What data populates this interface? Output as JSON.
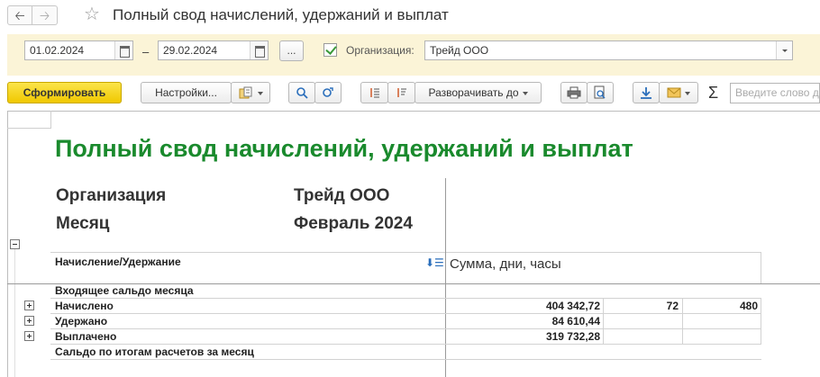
{
  "window": {
    "title": "Полный свод начислений, удержаний и выплат"
  },
  "params": {
    "date_from": "01.02.2024",
    "date_to": "29.02.2024",
    "period_sep": "–",
    "select_period_label": "...",
    "org_checked": true,
    "org_label": "Организация:",
    "org_value": "Трейд ООО"
  },
  "toolbar": {
    "generate_label": "Сформировать",
    "settings_label": "Настройки...",
    "expand_label": "Разворачивать до",
    "sum_symbol": "Σ",
    "search_placeholder": "Введите слово д"
  },
  "report": {
    "title": "Полный свод начислений, удержаний и выплат",
    "org_caption": "Организация",
    "org_value": "Трейд ООО",
    "month_caption": "Месяц",
    "month_value": "Февраль 2024",
    "col_item_header": "Начисление/Удержание",
    "col_sum_header": "Сумма, дни, часы",
    "rows": [
      {
        "label": "Входящее сальдо месяца",
        "sum": "",
        "days": "",
        "hours": ""
      },
      {
        "label": "Начислено",
        "sum": "404 342,72",
        "days": "72",
        "hours": "480"
      },
      {
        "label": "Удержано",
        "sum": "84 610,44",
        "days": "",
        "hours": ""
      },
      {
        "label": "Выплачено",
        "sum": "319 732,28",
        "days": "",
        "hours": ""
      },
      {
        "label": "Сальдо по итогам расчетов за месяц",
        "sum": "",
        "days": "",
        "hours": ""
      }
    ]
  },
  "colors": {
    "accent_yellow": "#f0c800",
    "params_bg": "#fbf4d7",
    "title_green": "#1a8a2d"
  }
}
